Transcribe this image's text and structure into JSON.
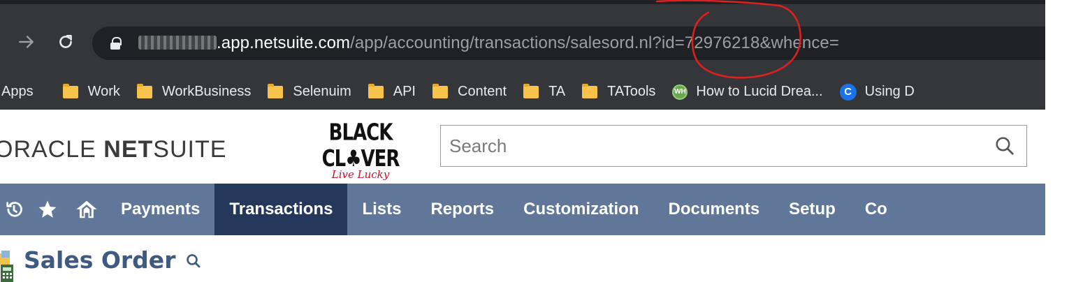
{
  "browser": {
    "url_domain": ".app.netsuite.com",
    "url_path": "/app/accounting/transactions/salesord.nl?id=72976218&whence="
  },
  "bookmarks": [
    {
      "label": "Apps",
      "icon": "apps-grid-icon"
    },
    {
      "label": "Work",
      "icon": "folder-icon"
    },
    {
      "label": "WorkBusiness",
      "icon": "folder-icon"
    },
    {
      "label": "Selenuim",
      "icon": "folder-icon"
    },
    {
      "label": "API",
      "icon": "folder-icon"
    },
    {
      "label": "Content",
      "icon": "folder-icon"
    },
    {
      "label": "TA",
      "icon": "folder-icon"
    },
    {
      "label": "TATools",
      "icon": "folder-icon"
    },
    {
      "label": "How to Lucid Drea...",
      "icon": "wh-favicon",
      "icon_text": "WH"
    },
    {
      "label": "Using D",
      "icon": "c-favicon",
      "icon_text": "C"
    }
  ],
  "header": {
    "logo_oracle": "ORACLE",
    "logo_net": "NET",
    "logo_suite": "SUITE",
    "brand_main": "BLACK CL♣VER",
    "brand_tagline": "Live Lucky",
    "search_placeholder": "Search"
  },
  "menu": {
    "items": [
      {
        "label": "Payments",
        "active": false
      },
      {
        "label": "Transactions",
        "active": true
      },
      {
        "label": "Lists",
        "active": false
      },
      {
        "label": "Reports",
        "active": false
      },
      {
        "label": "Customization",
        "active": false
      },
      {
        "label": "Documents",
        "active": false
      },
      {
        "label": "Setup",
        "active": false
      },
      {
        "label": "Co",
        "active": false
      }
    ]
  },
  "page": {
    "title": "Sales Order"
  },
  "colors": {
    "menubar": "#607799",
    "menu_active": "#24385b",
    "title": "#3e5a80",
    "annotation": "#e02020"
  }
}
